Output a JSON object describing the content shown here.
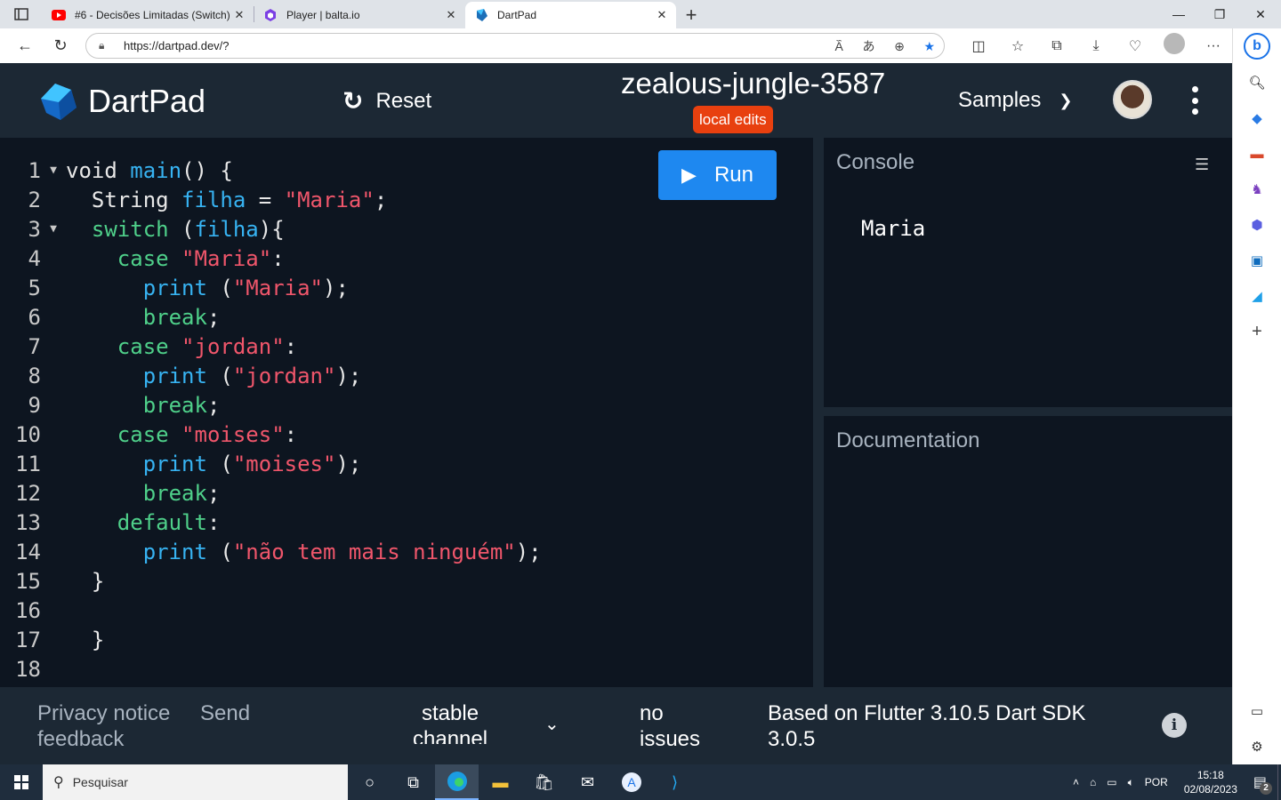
{
  "browser": {
    "tabs": [
      {
        "title": "#6 - Decisões Limitadas (Switch)",
        "icon": "youtube-icon"
      },
      {
        "title": "Player | balta.io",
        "icon": "balta-icon"
      },
      {
        "title": "DartPad",
        "icon": "dartpad-icon",
        "active": true
      }
    ],
    "url": "https://dartpad.dev/?"
  },
  "dartpad": {
    "brand": "DartPad",
    "reset_label": "Reset",
    "pad_title": "zealous-jungle-3587",
    "edits_badge": "local edits",
    "samples_label": "Samples",
    "run_label": "Run",
    "console_title": "Console",
    "console_output": "Maria",
    "docs_title": "Documentation",
    "code_lines": [
      "void main() {",
      "  String filha = \"Maria\";",
      "  switch (filha){",
      "    case \"Maria\":",
      "      print (\"Maria\");",
      "      break;",
      "    case \"jordan\":",
      "      print (\"jordan\");",
      "      break;",
      "    case \"moises\":",
      "      print (\"moises\");",
      "      break;",
      "    default:",
      "      print (\"não tem mais ninguém\");",
      "  }",
      "",
      "  }",
      ""
    ],
    "footer": {
      "privacy": "Privacy notice",
      "send": "Send",
      "feedback": "feedback",
      "channel_line1": "stable",
      "channel_line2": "channel",
      "issues_line1": "no",
      "issues_line2": "issues",
      "version_line1": "Based on Flutter 3.10.5 Dart SDK",
      "version_line2": "3.0.5"
    }
  },
  "taskbar": {
    "search_placeholder": "Pesquisar",
    "language": "POR",
    "time": "15:18",
    "date": "02/08/2023",
    "notification_count": "2"
  }
}
